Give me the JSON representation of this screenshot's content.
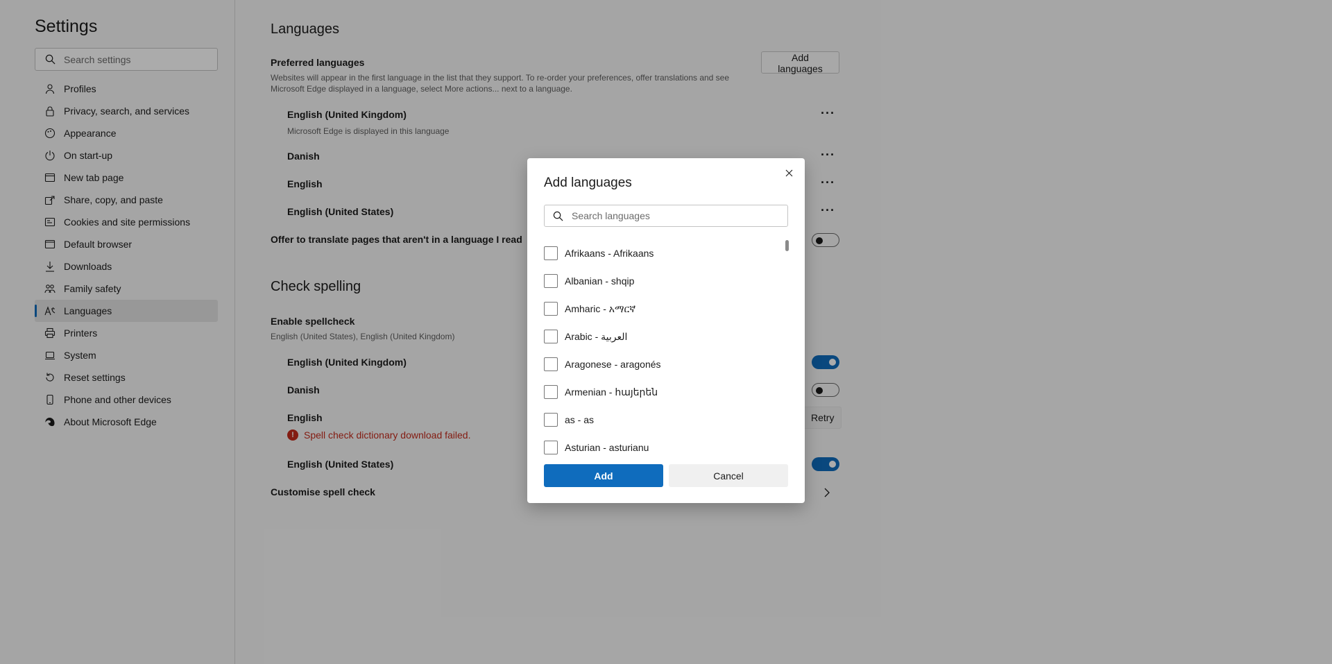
{
  "sidebar": {
    "title": "Settings",
    "search_placeholder": "Search settings",
    "items": [
      {
        "label": "Profiles",
        "icon": "person-icon"
      },
      {
        "label": "Privacy, search, and services",
        "icon": "lock-icon"
      },
      {
        "label": "Appearance",
        "icon": "palette-icon"
      },
      {
        "label": "On start-up",
        "icon": "power-icon"
      },
      {
        "label": "New tab page",
        "icon": "newtab-icon"
      },
      {
        "label": "Share, copy, and paste",
        "icon": "share-icon"
      },
      {
        "label": "Cookies and site permissions",
        "icon": "cookies-icon"
      },
      {
        "label": "Default browser",
        "icon": "browser-icon"
      },
      {
        "label": "Downloads",
        "icon": "download-icon"
      },
      {
        "label": "Family safety",
        "icon": "family-icon"
      },
      {
        "label": "Languages",
        "icon": "languages-icon",
        "active": true
      },
      {
        "label": "Printers",
        "icon": "printer-icon"
      },
      {
        "label": "System",
        "icon": "laptop-icon"
      },
      {
        "label": "Reset settings",
        "icon": "reset-icon"
      },
      {
        "label": "Phone and other devices",
        "icon": "phone-icon"
      },
      {
        "label": "About Microsoft Edge",
        "icon": "edge-icon"
      }
    ]
  },
  "main": {
    "title": "Languages",
    "preferred": {
      "label": "Preferred languages",
      "add_button": "Add languages",
      "description_line1": "Websites will appear in the first language in the list that they support. To re-order your preferences, offer translations and see",
      "description_line2": "Microsoft Edge displayed in a language, select More actions... next to a language.",
      "languages": [
        {
          "name": "English (United Kingdom)",
          "note": "Microsoft Edge is displayed in this language"
        },
        {
          "name": "Danish"
        },
        {
          "name": "English"
        },
        {
          "name": "English (United States)"
        }
      ],
      "more_label": "···"
    },
    "translate": {
      "label": "Offer to translate pages that aren't in a language I read",
      "enabled": false
    },
    "spell": {
      "title": "Check spelling",
      "enable_label": "Enable spellcheck",
      "enable_desc": "English (United States), English (United Kingdom)",
      "languages": [
        {
          "name": "English (United Kingdom)",
          "enabled": true
        },
        {
          "name": "Danish",
          "enabled": false
        },
        {
          "name": "English",
          "error": "Spell check dictionary download failed.",
          "retry": "Retry"
        },
        {
          "name": "English (United States)",
          "enabled": true
        }
      ],
      "customise_label": "Customise spell check"
    }
  },
  "dialog": {
    "title": "Add languages",
    "search_placeholder": "Search languages",
    "options": [
      "Afrikaans - Afrikaans",
      "Albanian - shqip",
      "Amharic - አማርኛ",
      "Arabic - العربية",
      "Aragonese - aragonés",
      "Armenian - հայերեն",
      "as - as",
      "Asturian - asturianu"
    ],
    "add_label": "Add",
    "cancel_label": "Cancel"
  },
  "colors": {
    "accent": "#0f6cbd",
    "error": "#c42b1c"
  }
}
